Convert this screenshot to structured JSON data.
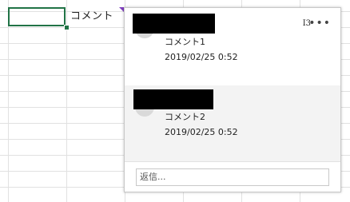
{
  "cell": {
    "text": "コメント"
  },
  "comment_pane": {
    "cell_ref": "I3",
    "more_icon": "•••",
    "threads": [
      {
        "text": "コメント1",
        "time": "2019/02/25 0:52"
      },
      {
        "text": "コメント2",
        "time": "2019/02/25 0:52"
      }
    ],
    "reply_placeholder": "返信..."
  },
  "colors": {
    "selection": "#217346",
    "comment_indicator": "#7f3fbf"
  }
}
